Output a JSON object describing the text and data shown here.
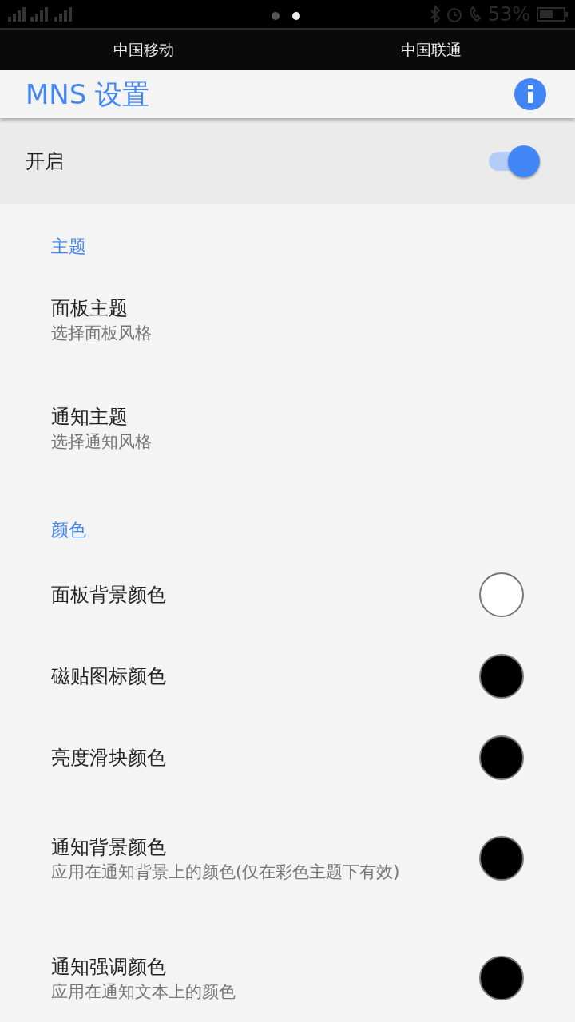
{
  "status_bar": {
    "battery": "53%",
    "pages": [
      {
        "selected": false
      },
      {
        "selected": true
      }
    ]
  },
  "carriers": [
    "中国移动",
    "中国联通"
  ],
  "title": "MNS 设置",
  "master": {
    "label": "开启",
    "on": true
  },
  "sections": [
    {
      "header": "主题",
      "items": [
        {
          "kind": "plain",
          "title": "面板主题",
          "summary": "选择面板风格"
        },
        {
          "kind": "plain",
          "title": "通知主题",
          "summary": "选择通知风格"
        }
      ]
    },
    {
      "header": "颜色",
      "items": [
        {
          "kind": "color",
          "title": "面板背景颜色",
          "color": "#ffffff"
        },
        {
          "kind": "color",
          "title": "磁贴图标颜色",
          "color": "#000000"
        },
        {
          "kind": "color",
          "title": "亮度滑块颜色",
          "color": "#000000"
        },
        {
          "kind": "color",
          "title": "通知背景颜色",
          "summary": "应用在通知背景上的颜色(仅在彩色主题下有效)",
          "color": "#000000"
        },
        {
          "kind": "color",
          "title": "通知强调颜色",
          "summary": "应用在通知文本上的颜色",
          "color": "#000000"
        }
      ]
    }
  ]
}
